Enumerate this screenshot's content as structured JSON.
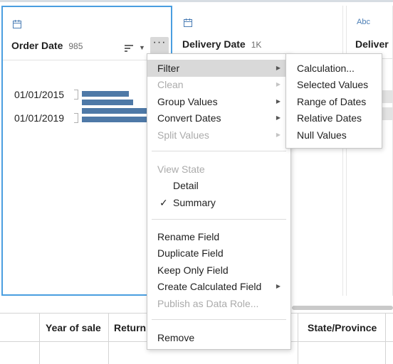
{
  "cards": [
    {
      "name": "Order Date",
      "count": "985",
      "type_icon": "calendar-icon"
    },
    {
      "name": "Delivery Date",
      "count": "1K",
      "type_icon": "calendar-icon"
    },
    {
      "name": "Deliver",
      "type_icon": "abc-icon",
      "type_label": "Abc"
    }
  ],
  "histogram": {
    "labels": [
      "01/01/2015",
      "01/01/2019"
    ],
    "bars": [
      0.72,
      0.78,
      1.0,
      1.0
    ]
  },
  "menu": {
    "filter": "Filter",
    "clean": "Clean",
    "group_values": "Group Values",
    "convert_dates": "Convert Dates",
    "split_values": "Split Values",
    "view_state": "View State",
    "detail": "Detail",
    "summary": "Summary",
    "check": "✓",
    "rename_field": "Rename Field",
    "duplicate_field": "Duplicate Field",
    "keep_only_field": "Keep Only Field",
    "create_calculated_field": "Create Calculated Field",
    "publish_as_data_role": "Publish as Data Role...",
    "remove": "Remove"
  },
  "submenu": {
    "calculation": "Calculation...",
    "selected_values": "Selected Values",
    "range_of_dates": "Range of Dates",
    "relative_dates": "Relative Dates",
    "null_values": "Null Values"
  },
  "grid": {
    "columns": [
      "Year of sale",
      "Return",
      "State/Province"
    ]
  },
  "colors": {
    "accent": "#4a9ee0",
    "bar": "#4e79a7",
    "menu_hover": "#d9d9d9"
  }
}
